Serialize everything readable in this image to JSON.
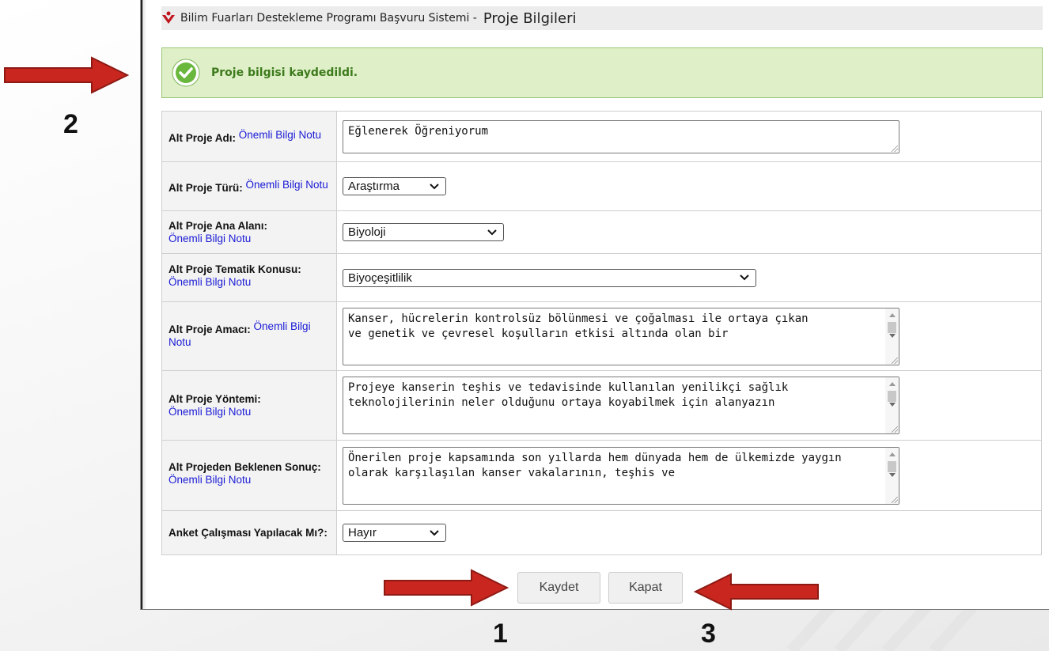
{
  "header": {
    "app_title": "Bilim Fuarları Destekleme Programı Başvuru Sistemi -",
    "page_title": "Proje Bilgileri"
  },
  "alert": {
    "message": "Proje bilgisi kaydedildi."
  },
  "form": {
    "note_link": "Önemli Bilgi Notu",
    "rows": [
      {
        "label": "Alt Proje Adı:",
        "value": "Eğlenerek Öğreniyorum"
      },
      {
        "label": "Alt Proje Türü:",
        "value": "Araştırma"
      },
      {
        "label": "Alt Proje Ana Alanı:",
        "value": "Biyoloji"
      },
      {
        "label": "Alt Proje Tematik Konusu:",
        "value": "Biyoçeşitlilik"
      },
      {
        "label": "Alt Proje Amacı:",
        "value": "Kanser, hücrelerin kontrolsüz bölünmesi ve çoğalması ile ortaya çıkan\nve genetik ve çevresel koşulların etkisi altında olan bir"
      },
      {
        "label": "Alt Proje Yöntemi:",
        "value": "Projeye kanserin teşhis ve tedavisinde kullanılan yenilikçi sağlık\nteknolojilerinin neler olduğunu ortaya koyabilmek için alanyazın"
      },
      {
        "label": "Alt Projeden Beklenen Sonuç:",
        "value": "Önerilen proje kapsamında son yıllarda hem dünyada hem de ülkemizde yaygın olarak karşılaşılan kanser vakalarının, teşhis ve"
      },
      {
        "label": "Anket Çalışması Yapılacak Mı?:",
        "value": "Hayır"
      }
    ]
  },
  "buttons": {
    "save": "Kaydet",
    "close": "Kapat"
  },
  "annotations": {
    "n1": "1",
    "n2": "2",
    "n3": "3"
  },
  "colors": {
    "arrow": "#c8261e",
    "success_bg": "#dff0c8",
    "success_text": "#3d7a1c",
    "link": "#1a1ad6"
  }
}
